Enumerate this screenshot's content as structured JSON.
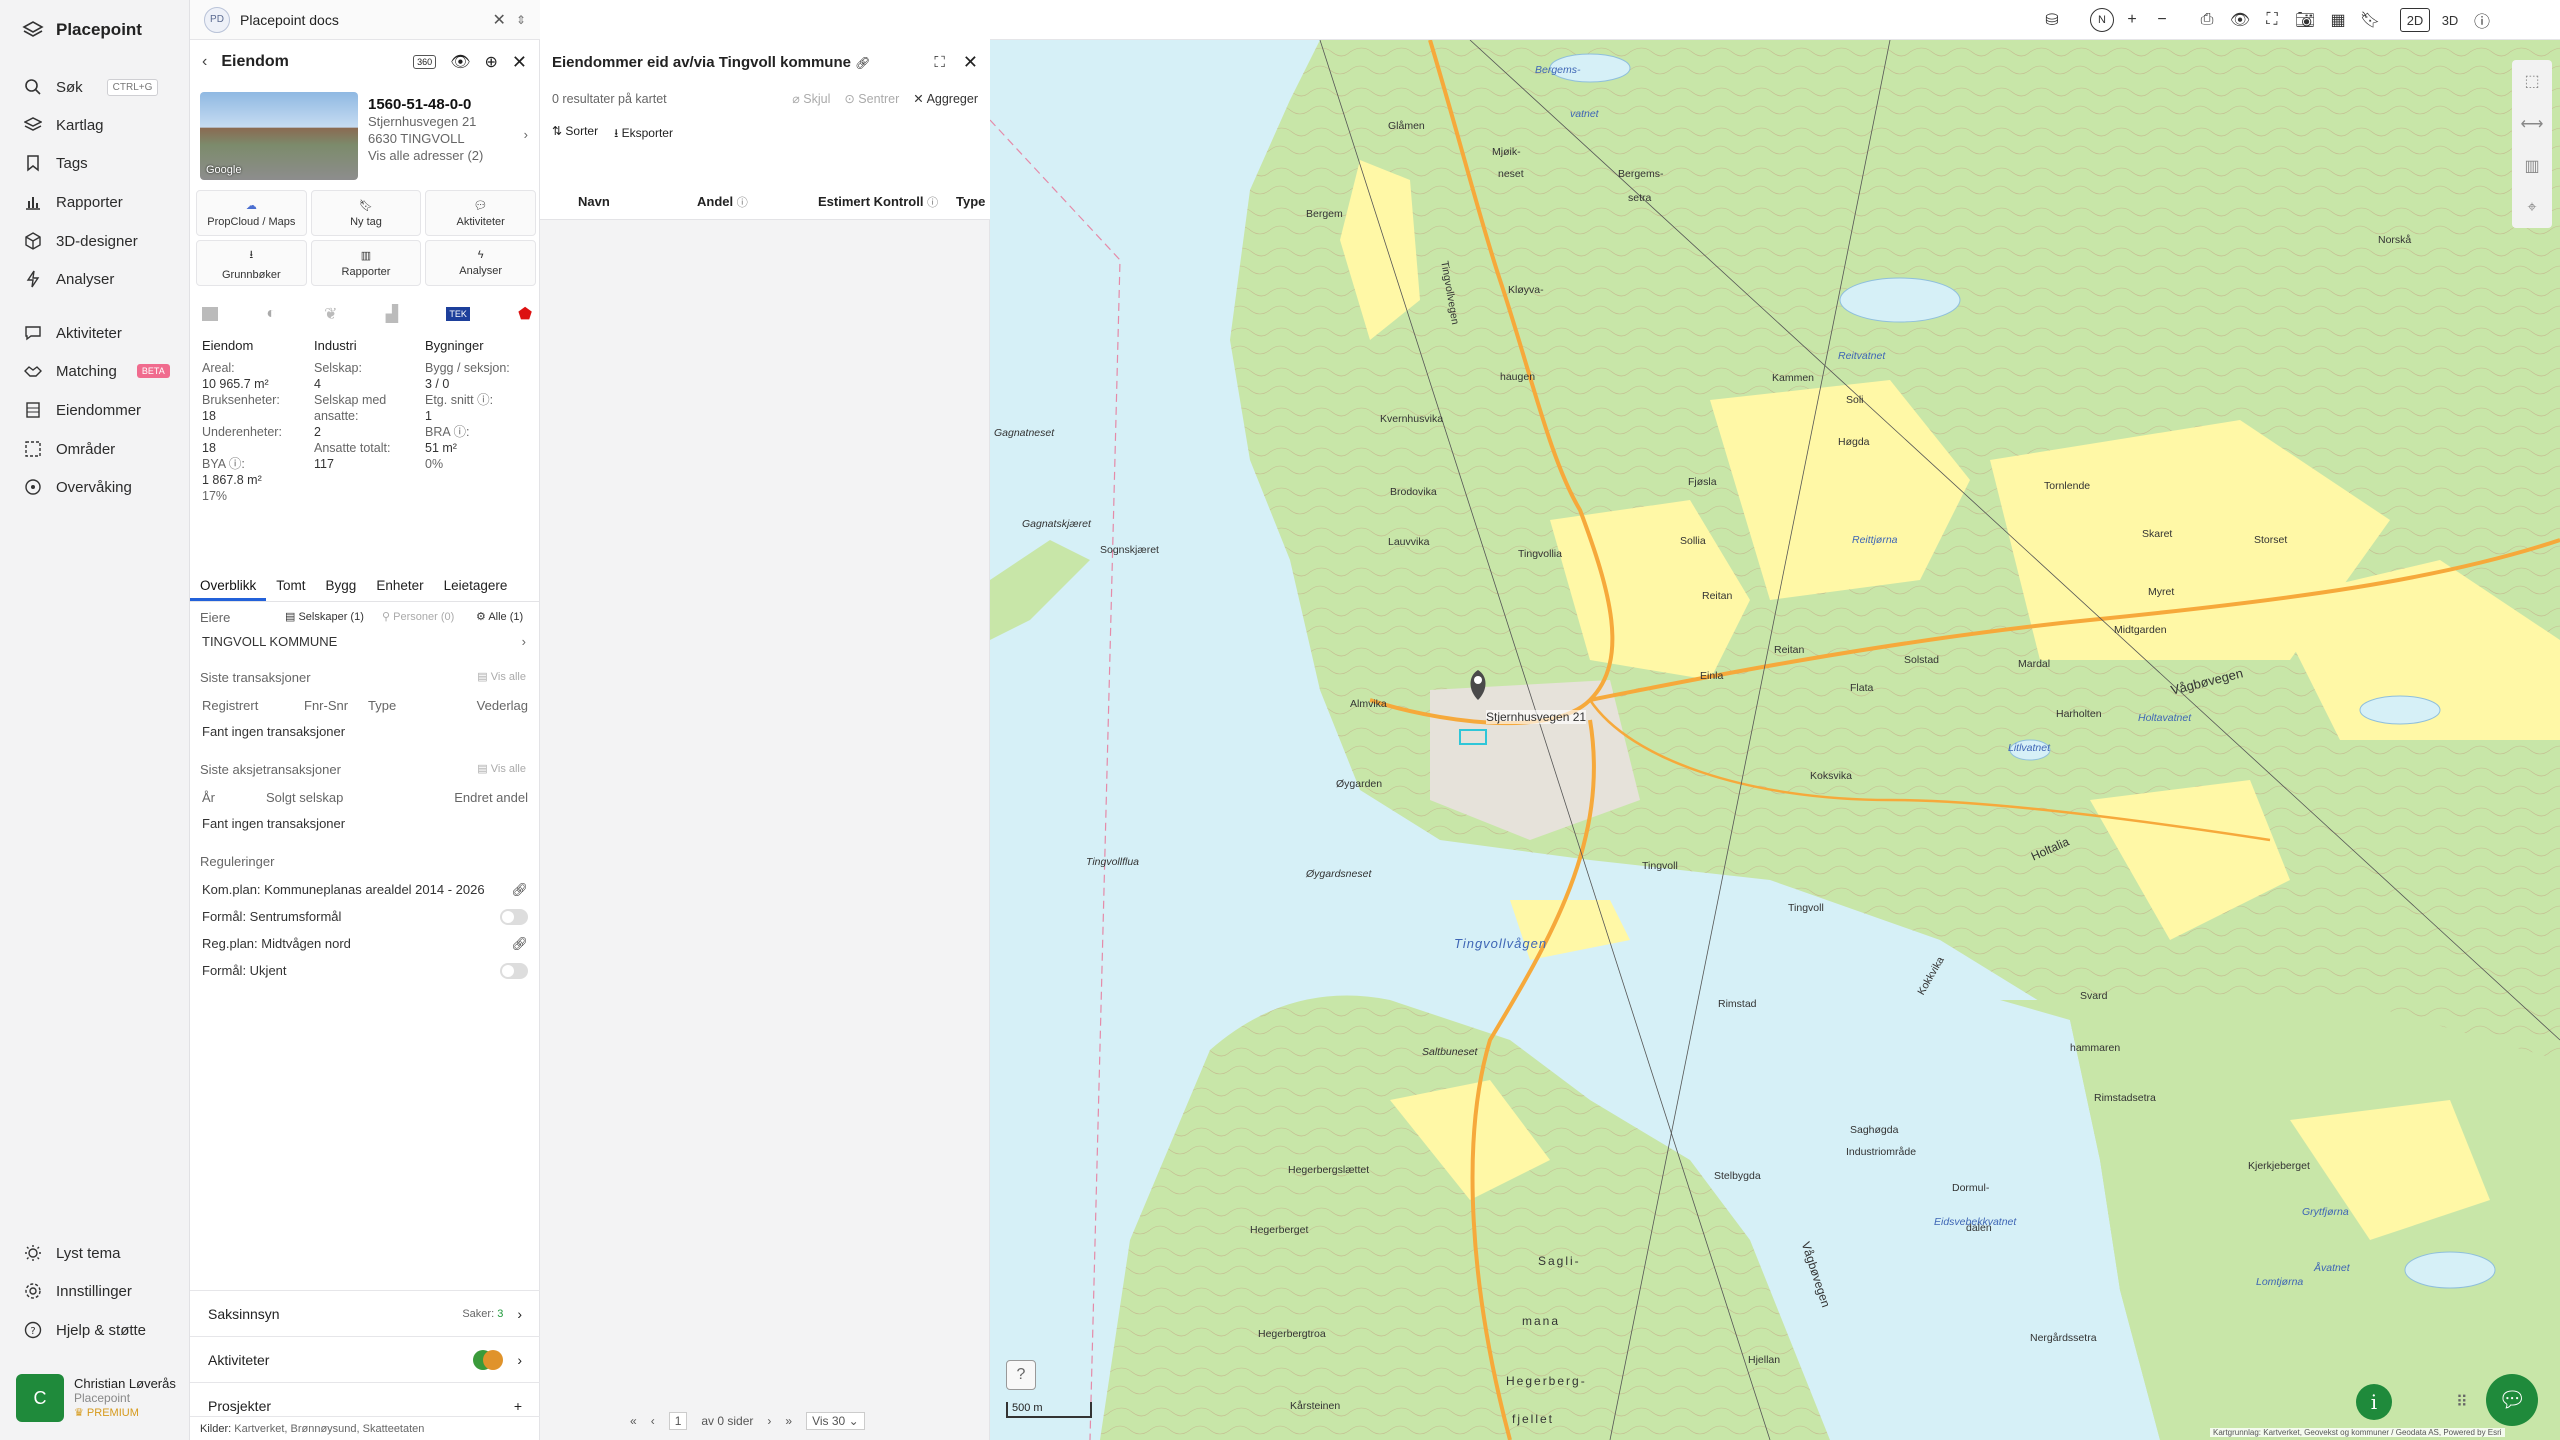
{
  "app": {
    "name": "Placepoint"
  },
  "nav": {
    "search": "Søk",
    "search_kbd": "CTRL+G",
    "map_layers": "Kartlag",
    "tags": "Tags",
    "reports": "Rapporter",
    "designer": "3D-designer",
    "analyses": "Analyser",
    "activities": "Aktiviteter",
    "matching": "Matching",
    "matching_badge": "BETA",
    "properties": "Eiendommer",
    "areas": "Områder",
    "monitoring": "Overvåking",
    "light_theme": "Lyst tema",
    "settings": "Innstillinger",
    "help": "Hjelp & støtte"
  },
  "user": {
    "initial": "C",
    "name": "Christian Løverås",
    "org": "Placepoint",
    "tier": "PREMIUM"
  },
  "doc_tab": {
    "badge": "PD",
    "title": "Placepoint docs"
  },
  "property": {
    "header": "Eiendom",
    "badge": "360",
    "id": "1560-51-48-0-0",
    "street": "Stjernhusvegen 21",
    "postal": "6630 TINGVOLL",
    "all_addresses": "Vis alle adresser (2)",
    "thumb_label": "Google",
    "buttons": [
      "PropCloud / Maps",
      "Ny tag",
      "Aktiviteter",
      "Grunnbøker",
      "Rapporter",
      "Analyser"
    ],
    "tek_label": "TEK",
    "stats": {
      "eiendom": {
        "title": "Eiendom",
        "areal_label": "Areal:",
        "areal": "10 965.7 m²",
        "bruks_label": "Bruksenheter:",
        "bruks": "18",
        "under_label": "Underenheter:",
        "under": "18",
        "bya_label": "BYA ⓘ:",
        "bya": "1 867.8 m²",
        "bya_pct": "17%"
      },
      "industri": {
        "title": "Industri",
        "selskap_label": "Selskap:",
        "selskap": "4",
        "ansatte_label": "Selskap med ansatte:",
        "ansatte": "2",
        "totalt_label": "Ansatte totalt:",
        "totalt": "117"
      },
      "bygninger": {
        "title": "Bygninger",
        "bygg_label": "Bygg / seksjon:",
        "bygg": "3 / 0",
        "etg_label": "Etg. snitt ⓘ:",
        "etg": "1",
        "bra_label": "BRA ⓘ:",
        "bra": "51 m²",
        "bra_pct": "0%"
      }
    },
    "tabs": [
      "Overblikk",
      "Tomt",
      "Bygg",
      "Enheter",
      "Leietagere"
    ],
    "owners": {
      "label": "Eiere",
      "companies": "Selskaper (1)",
      "persons": "Personer (0)",
      "all": "Alle (1)",
      "owner": "TINGVOLL KOMMUNE"
    },
    "transactions": {
      "title": "Siste transaksjoner",
      "show_all": "Vis alle",
      "cols": [
        "Registrert",
        "Fnr-Snr",
        "Type",
        "Vederlag"
      ],
      "empty": "Fant ingen transaksjoner"
    },
    "share_tx": {
      "title": "Siste aksjetransaksjoner",
      "show_all": "Vis alle",
      "cols": [
        "År",
        "Solgt selskap",
        "Endret andel"
      ],
      "empty": "Fant ingen transaksjoner"
    },
    "regulations": {
      "title": "Reguleringer",
      "komplan": "Kom.plan: Kommuneplanas arealdel 2014 - 2026",
      "formal1": "Formål: Sentrumsformål",
      "regplan": "Reg.plan: Midtvågen nord",
      "formal2": "Formål: Ukjent"
    },
    "accordions": {
      "cases": "Saksinnsyn",
      "cases_count_label": "Saker:",
      "cases_count": "3",
      "activities": "Aktiviteter",
      "projects": "Prosjekter"
    },
    "sources": {
      "label": "Kilder:",
      "items": "Kartverket, Brønnøysund, Skatteetaten"
    }
  },
  "results": {
    "title": "Eiendommer eid av/via Tingvoll kommune",
    "count": "0 resultater på kartet",
    "hide": "Skjul",
    "center": "Sentrer",
    "aggregate": "Aggreger",
    "sort": "Sorter",
    "export": "Eksporter",
    "cols": [
      "Navn",
      "Andel",
      "Estimert Kontroll",
      "Type"
    ],
    "pager": {
      "page": "1",
      "of": "av 0 sider",
      "show": "Vis 30"
    }
  },
  "map": {
    "mode_2d": "2D",
    "mode_3d": "3D",
    "north": "N",
    "scale": "500 m",
    "pin_label": "Stjernhusvegen 21",
    "attribution": "Kartgrunnlag: Kartverket, Geovekst og kommuner / Geodata AS, Powered by Esri",
    "labels": {
      "bergems": "Bergems-",
      "vatnet": "vatnet",
      "glamen": "Glåmen",
      "mjoik": "Mjøik-",
      "neset": "neset",
      "bergemsetra1": "Bergems-",
      "bergemsetra2": "setra",
      "bergem": "Bergem",
      "norsko": "Norskå",
      "kloyva": "Kløyva-",
      "haugen": "haugen",
      "kammen": "Kammen",
      "kvernhusvika": "Kvernhusvika",
      "gagnatneset": "Gagnatneset",
      "brodovika": "Brodovika",
      "fjosla": "Fjøsla",
      "lauvvika": "Lauvvika",
      "gagnatskjaeret": "Gagnatskjæret",
      "sognskjaeret": "Sognskjæret",
      "tingvollvegen": "Tingvollvegen",
      "reitvatnet": "Reitvatnet",
      "soli": "Soli",
      "hogda": "Høgda",
      "tornlende": "Tornlende",
      "skaret": "Skaret",
      "storset": "Storset",
      "reittjorna": "Reittjørna",
      "sollia": "Sollia",
      "tingvollia": "Tingvollia",
      "myret": "Myret",
      "reitan": "Reitan",
      "midtgarden": "Midtgarden",
      "reitan2": "Reitan",
      "solstad": "Solstad",
      "mardal": "Mardal",
      "vagbovegen": "Vågbøvegen",
      "almvika": "Almvika",
      "einla": "Einla",
      "flata": "Flata",
      "harholten": "Harholten",
      "holtavatnet": "Holtavatnet",
      "litlvatnet": "Litlvatnet",
      "koksvika": "Koksvika",
      "oygarden": "Øygarden",
      "tingvoll1": "Tingvoll",
      "tingvollflua": "Tingvollflua",
      "oygardsneset": "Øygardsneset",
      "tingvoll2": "Tingvoll",
      "tingvollvagen": "Tingvollvågen",
      "holtalia": "Holtalia",
      "kokkvika": "Kokkvika",
      "svard": "Svard",
      "rimstad": "Rimstad",
      "saltbuneset": "Saltbuneset",
      "hammaren": "hammaren",
      "rimstadsetra": "Rimstadsetra",
      "saghogda": "Saghøgda",
      "industriomrade": "Industriområde",
      "hegerbergslaettet": "Hegerbergslættet",
      "stelbygda": "Stelbygda",
      "hegerberget": "Hegerberget",
      "dormul": "Dormul-",
      "dalen": "dalen",
      "kjerkjeberget": "Kjerkjeberget",
      "grytfjorna": "Grytfjørna",
      "eidsvebekkvatnet": "Eidsvebekkvatnet",
      "avatnet": "Åvatnet",
      "lomtjorna": "Lomtjørna",
      "sagli": "Sagli-",
      "mana": "mana",
      "hegerbergtroa": "Hegerbergtroa",
      "hegerberg2": "Hegerberg-",
      "fjellet": "fjellet",
      "nergarosetra": "Nergårdssetra",
      "kaarsteinen": "Kårsteinen",
      "hjellan": "Hjellan",
      "vagbovegen2": "Vågbøvegen"
    }
  },
  "colors": {
    "accent": "#2361d9",
    "water": "#d6f0f7",
    "forest": "#c8e6a8",
    "field": "#fff8a6",
    "road": "#f6a93b",
    "avatar": "#1f8a3b"
  }
}
